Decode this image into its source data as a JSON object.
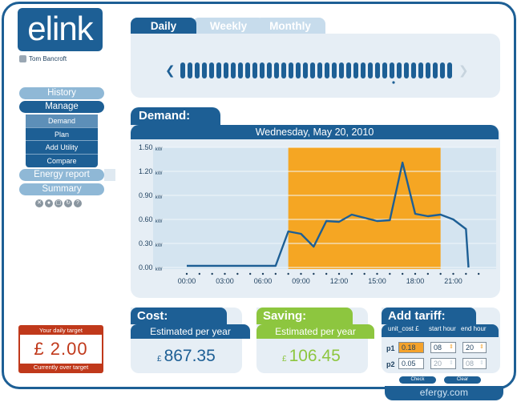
{
  "brand": {
    "logo": "elink",
    "footer": "efergy.com"
  },
  "user": {
    "name": "Tom Bancroft"
  },
  "nav": {
    "history": "History",
    "manage": "Manage",
    "sub": [
      "Demand",
      "Plan",
      "Add Utility",
      "Compare"
    ],
    "energy_report": "Energy report",
    "summary": "Summary",
    "small_icons": [
      "close-icon",
      "stop-icon",
      "window-icon",
      "refresh-icon",
      "help-icon"
    ]
  },
  "target": {
    "heading": "Your daily target",
    "value": "£ 2.00",
    "status": "Currently over target"
  },
  "tabs": [
    "Daily",
    "Weekly",
    "Monthly"
  ],
  "timeline": {
    "bars": 38,
    "prev_icon": "chevron-left-icon",
    "next_icon": "chevron-right-icon"
  },
  "demand": {
    "title": "Demand:",
    "date": "Wednesday, May 20, 2010"
  },
  "chart_data": {
    "type": "line",
    "yunit": "kW",
    "ylim": [
      0,
      1.5
    ],
    "yticks": [
      "0.00",
      "0.30",
      "0.60",
      "0.90",
      "1.20",
      "1.50"
    ],
    "xticks": [
      "00:00",
      "03:00",
      "06:00",
      "09:00",
      "12:00",
      "15:00",
      "18:00",
      "21:00"
    ],
    "xlim": [
      0,
      24
    ],
    "highlight_range": [
      8,
      20
    ],
    "highlight_color": "#f5a623",
    "x": [
      0,
      7,
      8,
      9,
      10,
      11,
      12,
      13,
      14,
      15,
      16,
      17,
      18,
      19,
      20,
      21,
      22,
      22.2
    ],
    "y": [
      0.02,
      0.02,
      0.45,
      0.42,
      0.26,
      0.58,
      0.57,
      0.66,
      0.62,
      0.58,
      0.59,
      1.31,
      0.67,
      0.64,
      0.66,
      0.6,
      0.48,
      0.0
    ]
  },
  "cost": {
    "title": "Cost:",
    "sub": "Estimated per year",
    "currency": "£",
    "value": "867.35"
  },
  "saving": {
    "title": "Saving:",
    "sub": "Estimated per year",
    "currency": "£",
    "value": "106.45"
  },
  "tariff": {
    "title": "Add tariff:",
    "cols": [
      "unit_cost £",
      "start hour",
      "end hour"
    ],
    "rows": [
      {
        "label": "p1",
        "cost": "0.18",
        "start": "08",
        "end": "20"
      },
      {
        "label": "p2",
        "cost": "0.05",
        "start": "20",
        "end": "08"
      }
    ],
    "check": "Check",
    "clear": "Clear"
  },
  "colors": {
    "primary": "#1d5f95",
    "light": "#8fb8d6",
    "panel": "#e6eef5",
    "highlight": "#f5a623",
    "saving": "#8dc63f",
    "alert": "#c0391b"
  }
}
